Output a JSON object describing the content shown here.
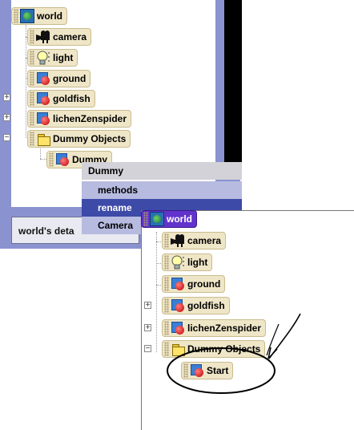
{
  "top_tree": {
    "world": "world",
    "camera": "camera",
    "light": "light",
    "ground": "ground",
    "goldfish": "goldfish",
    "lichen": "lichenZenspider",
    "dummy_objects": "Dummy Objects",
    "dummy": "Dummy"
  },
  "details_tab": "world's deta",
  "context_menu": {
    "title": "Dummy",
    "items": [
      "methods",
      "rename",
      "Camera"
    ]
  },
  "bottom_tree": {
    "world": "world",
    "camera": "camera",
    "light": "light",
    "ground": "ground",
    "goldfish": "goldfish",
    "lichen": "lichenZenspider",
    "dummy_objects": "Dummy Objects",
    "start": "Start"
  },
  "icons": {
    "world": "globe-icon",
    "camera": "camera-icon",
    "light": "lightbulb-icon",
    "object": "object-icon",
    "folder": "folder-icon"
  },
  "colors": {
    "panel_background": "#8a93cf",
    "selected_item": "#3e4aa8",
    "world_selected": "#6233cc",
    "node_fill": "#efe6c8"
  }
}
